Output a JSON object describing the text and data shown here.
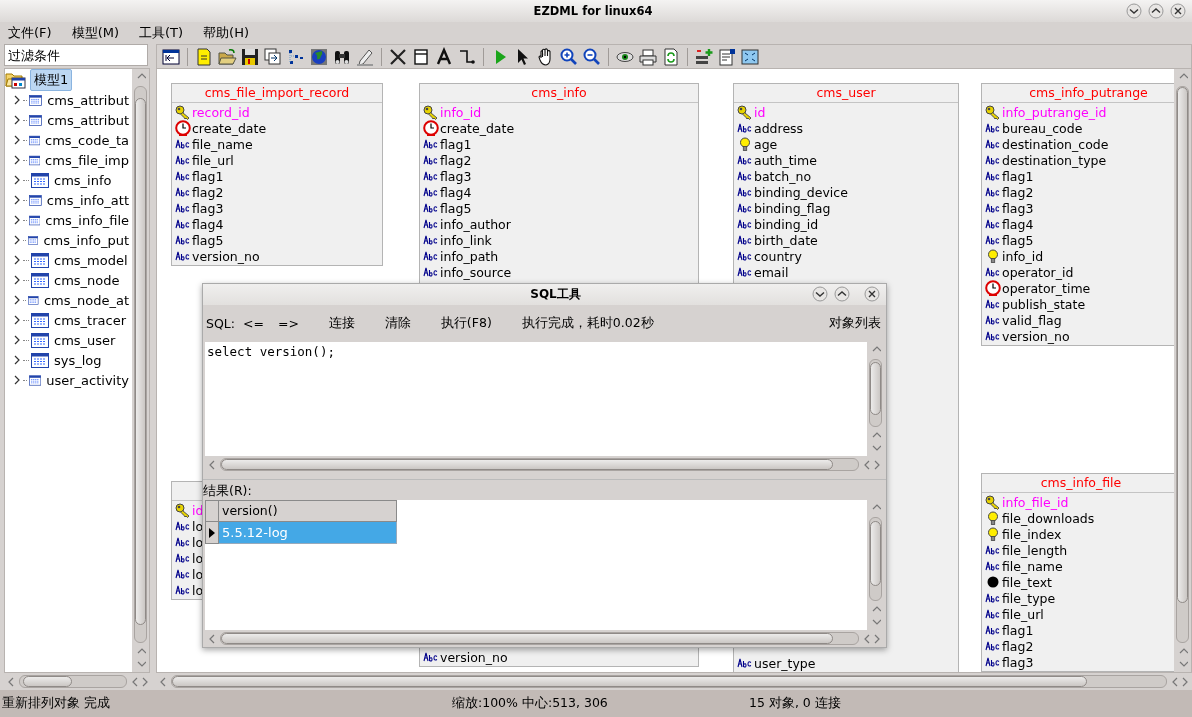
{
  "window": {
    "title": "EZDML for linux64"
  },
  "menu": [
    "文件(F)",
    "模型(M)",
    "工具(T)",
    "帮助(H)"
  ],
  "filter": {
    "placeholder": "过滤条件"
  },
  "tree": {
    "label": "模型1",
    "selected": true,
    "expanded": true,
    "children": [
      {
        "label": "cms_attribut",
        "selected": false,
        "expanded": false
      },
      {
        "label": "cms_attribut",
        "selected": false,
        "expanded": false
      },
      {
        "label": "cms_code_ta",
        "selected": false,
        "expanded": false
      },
      {
        "label": "cms_file_imp",
        "selected": false,
        "expanded": false
      },
      {
        "label": "cms_info",
        "selected": false,
        "expanded": false
      },
      {
        "label": "cms_info_att",
        "selected": false,
        "expanded": false
      },
      {
        "label": "cms_info_file",
        "selected": false,
        "expanded": false
      },
      {
        "label": "cms_info_put",
        "selected": false,
        "expanded": false
      },
      {
        "label": "cms_model",
        "selected": false,
        "expanded": false
      },
      {
        "label": "cms_node",
        "selected": false,
        "expanded": false
      },
      {
        "label": "cms_node_at",
        "selected": false,
        "expanded": false
      },
      {
        "label": "cms_tracer",
        "selected": false,
        "expanded": false
      },
      {
        "label": "cms_user",
        "selected": false,
        "expanded": false
      },
      {
        "label": "sys_log",
        "selected": false,
        "expanded": false
      },
      {
        "label": "user_activity",
        "selected": false,
        "expanded": false
      }
    ]
  },
  "entities": [
    {
      "name": "cms_file_import_record",
      "fields": [
        {
          "name": "record_id",
          "kind": "key"
        },
        {
          "name": "create_date",
          "kind": "date"
        },
        {
          "name": "file_name",
          "kind": "text"
        },
        {
          "name": "file_url",
          "kind": "text"
        },
        {
          "name": "flag1",
          "kind": "text"
        },
        {
          "name": "flag2",
          "kind": "text"
        },
        {
          "name": "flag3",
          "kind": "text"
        },
        {
          "name": "flag4",
          "kind": "text"
        },
        {
          "name": "flag5",
          "kind": "text"
        },
        {
          "name": "version_no",
          "kind": "text"
        }
      ]
    },
    {
      "name": "cms_info",
      "fields": [
        {
          "name": "info_id",
          "kind": "key"
        },
        {
          "name": "create_date",
          "kind": "date"
        },
        {
          "name": "flag1",
          "kind": "text"
        },
        {
          "name": "flag2",
          "kind": "text"
        },
        {
          "name": "flag3",
          "kind": "text"
        },
        {
          "name": "flag4",
          "kind": "text"
        },
        {
          "name": "flag5",
          "kind": "text"
        },
        {
          "name": "info_author",
          "kind": "text"
        },
        {
          "name": "info_link",
          "kind": "text"
        },
        {
          "name": "info_path",
          "kind": "text"
        },
        {
          "name": "info_source",
          "kind": "text"
        }
      ],
      "bottom_fields": [
        {
          "name": "version_no",
          "kind": "text"
        }
      ]
    },
    {
      "name": "cms_user",
      "fields": [
        {
          "name": "id",
          "kind": "key"
        },
        {
          "name": "address",
          "kind": "text"
        },
        {
          "name": "age",
          "kind": "number"
        },
        {
          "name": "auth_time",
          "kind": "text"
        },
        {
          "name": "batch_no",
          "kind": "text"
        },
        {
          "name": "binding_device",
          "kind": "text"
        },
        {
          "name": "binding_flag",
          "kind": "text"
        },
        {
          "name": "binding_id",
          "kind": "text"
        },
        {
          "name": "birth_date",
          "kind": "text"
        },
        {
          "name": "country",
          "kind": "text"
        },
        {
          "name": "email",
          "kind": "text"
        }
      ],
      "bottom_fields": [
        {
          "name": "user_type",
          "kind": "text"
        }
      ]
    },
    {
      "name": "cms_info_putrange",
      "fields": [
        {
          "name": "info_putrange_id",
          "kind": "key"
        },
        {
          "name": "bureau_code",
          "kind": "text"
        },
        {
          "name": "destination_code",
          "kind": "text"
        },
        {
          "name": "destination_type",
          "kind": "text"
        },
        {
          "name": "flag1",
          "kind": "text"
        },
        {
          "name": "flag2",
          "kind": "text"
        },
        {
          "name": "flag3",
          "kind": "text"
        },
        {
          "name": "flag4",
          "kind": "text"
        },
        {
          "name": "flag5",
          "kind": "text"
        },
        {
          "name": "info_id",
          "kind": "number"
        },
        {
          "name": "operator_id",
          "kind": "text"
        },
        {
          "name": "operator_time",
          "kind": "date"
        },
        {
          "name": "publish_state",
          "kind": "text"
        },
        {
          "name": "valid_flag",
          "kind": "text"
        },
        {
          "name": "version_no",
          "kind": "text"
        }
      ]
    },
    {
      "name": "cms_info_file",
      "fields": [
        {
          "name": "info_file_id",
          "kind": "key"
        },
        {
          "name": "file_downloads",
          "kind": "number"
        },
        {
          "name": "file_index",
          "kind": "number"
        },
        {
          "name": "file_length",
          "kind": "text"
        },
        {
          "name": "file_name",
          "kind": "text"
        },
        {
          "name": "file_text",
          "kind": "blob"
        },
        {
          "name": "file_type",
          "kind": "text"
        },
        {
          "name": "file_url",
          "kind": "text"
        },
        {
          "name": "flag1",
          "kind": "text"
        },
        {
          "name": "flag2",
          "kind": "text"
        },
        {
          "name": "flag3",
          "kind": "text"
        }
      ]
    },
    {
      "fields": [
        {
          "name": "id",
          "kind": "key"
        },
        {
          "name": "lo",
          "kind": "text"
        },
        {
          "name": "lo",
          "kind": "text"
        },
        {
          "name": "lo",
          "kind": "text"
        },
        {
          "name": "lo",
          "kind": "text"
        },
        {
          "name": "lo",
          "kind": "text"
        }
      ]
    }
  ],
  "sql_dialog": {
    "title": "SQL工具",
    "label": "SQL:",
    "buttons": [
      "<=",
      "=>",
      "连接",
      "清除",
      "执行(F8)"
    ],
    "message": "执行完成，耗时0.02秒",
    "object_list": "对象列表",
    "query": "select version();",
    "results_label": "结果(R):",
    "results": {
      "columns": [
        "version()"
      ],
      "rows": [
        {
          "cells": [
            "5.5.12-log"
          ],
          "selected": true
        }
      ]
    }
  },
  "status_bar": [
    "重新排列对象 完成",
    "缩放:100% 中心:513, 306",
    "15 对象, 0 连接"
  ]
}
